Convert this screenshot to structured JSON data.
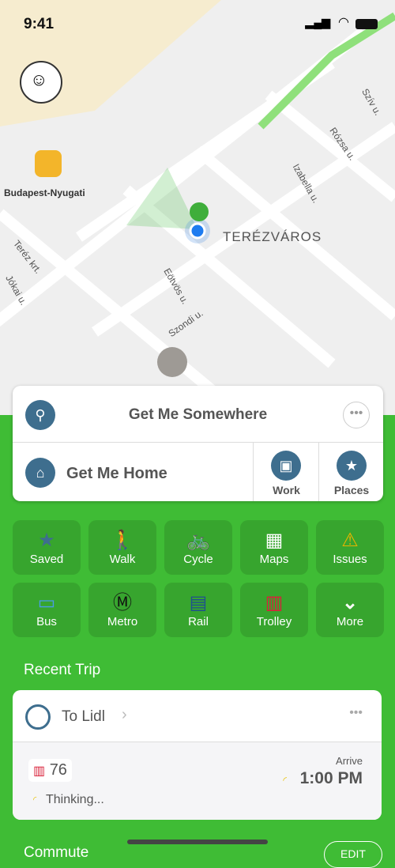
{
  "status": {
    "time": "9:41"
  },
  "map": {
    "station": "Budapest-Nyugati",
    "district": "TERÉZVÁROS",
    "streets": [
      "Teréz krt.",
      "Jókai u.",
      "Eötvös u.",
      "Szondi u.",
      "Izabella u.",
      "Rózsa u.",
      "Szív u."
    ]
  },
  "search": {
    "title": "Get Me Somewhere",
    "home": "Get Me Home",
    "work": "Work",
    "places": "Places"
  },
  "modes": [
    {
      "label": "Saved",
      "icon": "saved-icon",
      "glyph": "★"
    },
    {
      "label": "Walk",
      "icon": "walk-icon",
      "glyph": "🚶"
    },
    {
      "label": "Cycle",
      "icon": "bicycle-icon",
      "glyph": "🚲"
    },
    {
      "label": "Maps",
      "icon": "map-icon",
      "glyph": "▦"
    },
    {
      "label": "Issues",
      "icon": "warning-icon",
      "glyph": "⚠"
    },
    {
      "label": "Bus",
      "icon": "bus-icon",
      "glyph": "▭"
    },
    {
      "label": "Metro",
      "icon": "metro-icon",
      "glyph": "Ⓜ"
    },
    {
      "label": "Rail",
      "icon": "rail-icon",
      "glyph": "▤"
    },
    {
      "label": "Trolley",
      "icon": "trolley-icon",
      "glyph": "▥"
    },
    {
      "label": "More",
      "icon": "chevron-down-icon",
      "glyph": "⌄"
    }
  ],
  "colors": {
    "green": "#3fbc35",
    "tile": "#37a52e",
    "accent": "#3e6e8e",
    "trolley": "#d9213a",
    "warning": "#e8b400"
  },
  "recent": {
    "heading": "Recent Trip",
    "name": "To Lidl",
    "route": "76",
    "status": "Thinking...",
    "arrive_label": "Arrive",
    "arrive_time": "1:00 PM"
  },
  "commute": {
    "heading": "Commute",
    "edit": "EDIT"
  }
}
